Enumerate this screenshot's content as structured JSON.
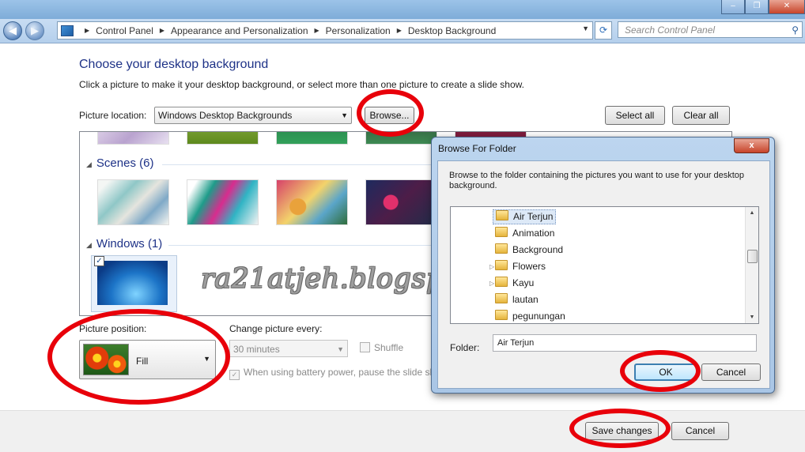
{
  "window": {
    "controls": [
      "–",
      "❐",
      "✕"
    ]
  },
  "address": {
    "back": "◀",
    "forward": "▶",
    "breadcrumb": [
      "Control Panel",
      "Appearance and Personalization",
      "Personalization",
      "Desktop Background"
    ],
    "search_placeholder": "Search Control Panel"
  },
  "main": {
    "heading": "Choose your desktop background",
    "subtext": "Click a picture to make it your desktop background, or select more than one picture to create a slide show.",
    "location_label": "Picture location:",
    "location_value": "Windows Desktop Backgrounds",
    "browse_button": "Browse...",
    "select_all_button": "Select all",
    "clear_all_button": "Clear all",
    "groups": [
      {
        "title": "Scenes (6)"
      },
      {
        "title": "Windows (1)"
      }
    ],
    "position_label": "Picture position:",
    "position_value": "Fill",
    "change_label": "Change picture every:",
    "change_value": "30 minutes",
    "shuffle_label": "Shuffle",
    "battery_label": "When using battery power, pause the slide show"
  },
  "footer": {
    "save_button": "Save changes",
    "cancel_button": "Cancel"
  },
  "watermark": "ra21atjeh.blogspot.com",
  "dialog": {
    "title": "Browse For Folder",
    "close": "x",
    "description": "Browse to the folder containing the pictures you want to use for your desktop background.",
    "folders": [
      {
        "name": "Air Terjun",
        "selected": true,
        "expandable": false
      },
      {
        "name": "Animation",
        "selected": false,
        "expandable": false
      },
      {
        "name": "Background",
        "selected": false,
        "expandable": false
      },
      {
        "name": "Flowers",
        "selected": false,
        "expandable": true
      },
      {
        "name": "Kayu",
        "selected": false,
        "expandable": true
      },
      {
        "name": "lautan",
        "selected": false,
        "expandable": false
      },
      {
        "name": "pegunungan",
        "selected": false,
        "expandable": false
      }
    ],
    "folder_label": "Folder:",
    "folder_value": "Air Terjun",
    "ok_button": "OK",
    "cancel_button": "Cancel"
  },
  "colors": {
    "highlight_ring": "#e8000a",
    "heading": "#1e3287"
  }
}
